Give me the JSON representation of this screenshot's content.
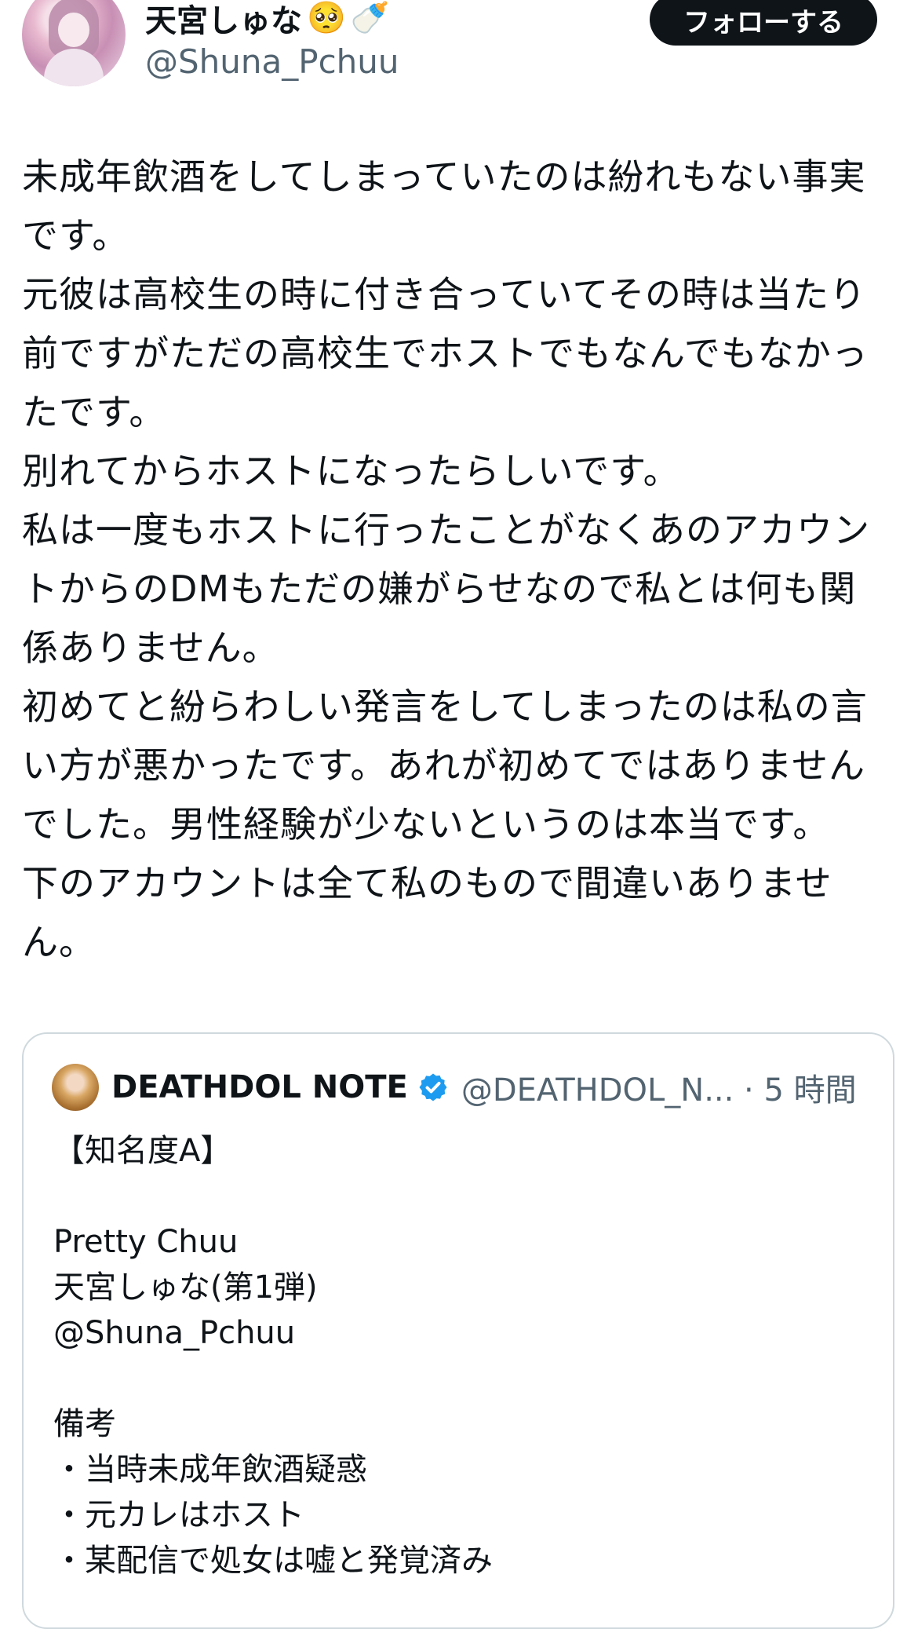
{
  "author": {
    "display_name": "天宮しゅな",
    "emoji_1": "🥺",
    "emoji_2": "🍼",
    "handle": "@Shuna_Pchuu",
    "follow_label": "フォローする"
  },
  "tweet": {
    "lines": [
      "未成年飲酒をしてしまっていたのは紛れもない事実です。",
      "元彼は高校生の時に付き合っていてその時は当たり前ですがただの高校生でホストでもなんでもなかったです。",
      "別れてからホストになったらしいです。",
      "私は一度もホストに行ったことがなくあのアカウントからのDMもただの嫌がらせなので私とは何も関係ありません。",
      "初めてと紛らわしい発言をしてしまったのは私の言い方が悪かったです。あれが初めてではありませんでした。男性経験が少ないというのは本当です。",
      "下のアカウントは全て私のもので間違いありません。"
    ]
  },
  "quote": {
    "name": "DEATHDOL NOTE",
    "handle_time": "@DEATHDOL_N... · 5 時間",
    "lines": [
      "【知名度A】",
      "",
      "Pretty Chuu",
      "天宮しゅな(第1弾)",
      "@Shuna_Pchuu",
      "",
      "備考",
      "・当時未成年飲酒疑惑",
      "・元カレはホスト",
      "・某配信で処女は嘘と発覚済み"
    ]
  },
  "colors": {
    "text": "#0f1419",
    "secondary": "#536471",
    "verified": "#1d9bf0",
    "border": "#cfd9de"
  }
}
